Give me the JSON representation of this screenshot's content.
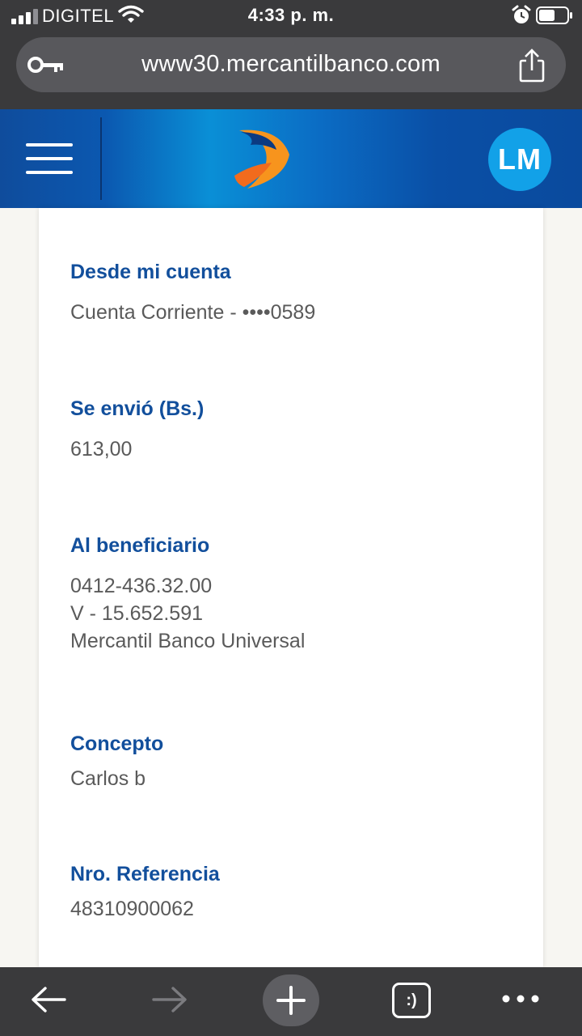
{
  "status_bar": {
    "carrier": "DIGITEL",
    "time": "4:33 p. m."
  },
  "browser": {
    "url": "www30.mercantilbanco.com"
  },
  "header": {
    "avatar_initials": "LM",
    "brand_colors": {
      "primary": "#0a4fa6",
      "accent": "#f7941d",
      "avatar": "#12a1e8"
    }
  },
  "receipt": {
    "from_account": {
      "label": "Desde mi cuenta",
      "value": "Cuenta Corriente - ••••0589"
    },
    "amount": {
      "label": "Se envió (Bs.)",
      "value": "613,00"
    },
    "beneficiary": {
      "label": "Al beneficiario",
      "phone": "0412-436.32.00",
      "id_number": "V - 15.652.591",
      "bank": "Mercantil Banco Universal"
    },
    "concept": {
      "label": "Concepto",
      "value": "Carlos b"
    },
    "reference": {
      "label": "Nro. Referencia",
      "value": "48310900062"
    }
  },
  "toolbar": {
    "tabs_label": ":)"
  }
}
